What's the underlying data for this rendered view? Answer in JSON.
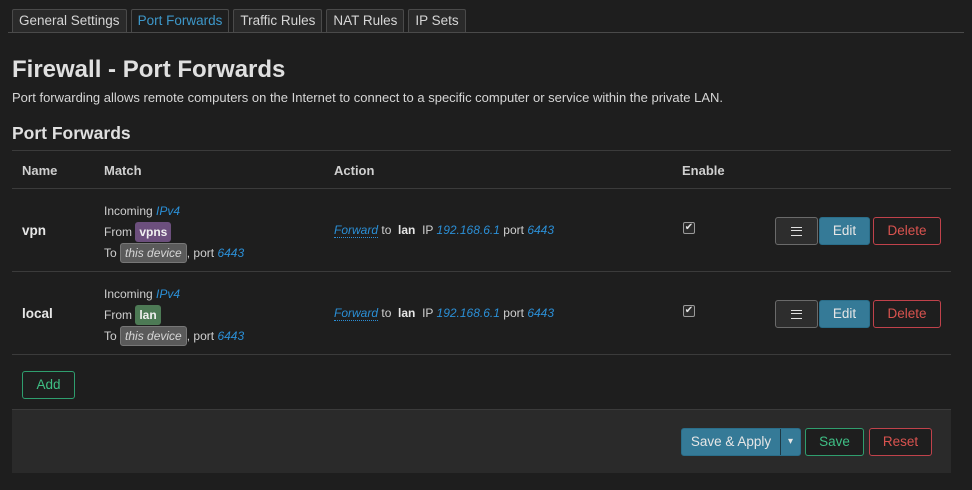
{
  "tabs": [
    {
      "label": "General Settings",
      "active": false
    },
    {
      "label": "Port Forwards",
      "active": true
    },
    {
      "label": "Traffic Rules",
      "active": false
    },
    {
      "label": "NAT Rules",
      "active": false
    },
    {
      "label": "IP Sets",
      "active": false
    }
  ],
  "page": {
    "title": "Firewall - Port Forwards",
    "description": "Port forwarding allows remote computers on the Internet to connect to a specific computer or service within the private LAN.",
    "section_title": "Port Forwards"
  },
  "table": {
    "headers": {
      "name": "Name",
      "match": "Match",
      "action": "Action",
      "enable": "Enable"
    },
    "rows": [
      {
        "name": "vpn",
        "incoming": "Incoming",
        "family": "IPv4",
        "from": "From",
        "zone": "vpns",
        "to": "To",
        "device": "this device",
        "port_label": ", port",
        "port": "6443",
        "forward": "Forward",
        "to_text": "to",
        "dest_zone": "lan",
        "ip_label": "IP",
        "ip": "192.168.6.1",
        "dport_label": "port",
        "dport": "6443",
        "enabled": true
      },
      {
        "name": "local",
        "incoming": "Incoming",
        "family": "IPv4",
        "from": "From",
        "zone": "lan",
        "to": "To",
        "device": "this device",
        "port_label": ", port",
        "port": "6443",
        "forward": "Forward",
        "to_text": "to",
        "dest_zone": "lan",
        "ip_label": "IP",
        "ip": "192.168.6.1",
        "dport_label": "port",
        "dport": "6443",
        "enabled": true
      }
    ],
    "row_buttons": {
      "edit": "Edit",
      "delete": "Delete"
    }
  },
  "add_label": "Add",
  "footer": {
    "save_apply": "Save & Apply",
    "split_arrow": "▾",
    "save": "Save",
    "reset": "Reset"
  },
  "checkmark": "✔",
  "colors": {
    "accent": "#357a97",
    "link": "#2b8fd6",
    "danger": "#d9534f",
    "success": "#3fbf85",
    "zone_vpns": "#6c4f7d",
    "zone_lan": "#4d7a55"
  }
}
